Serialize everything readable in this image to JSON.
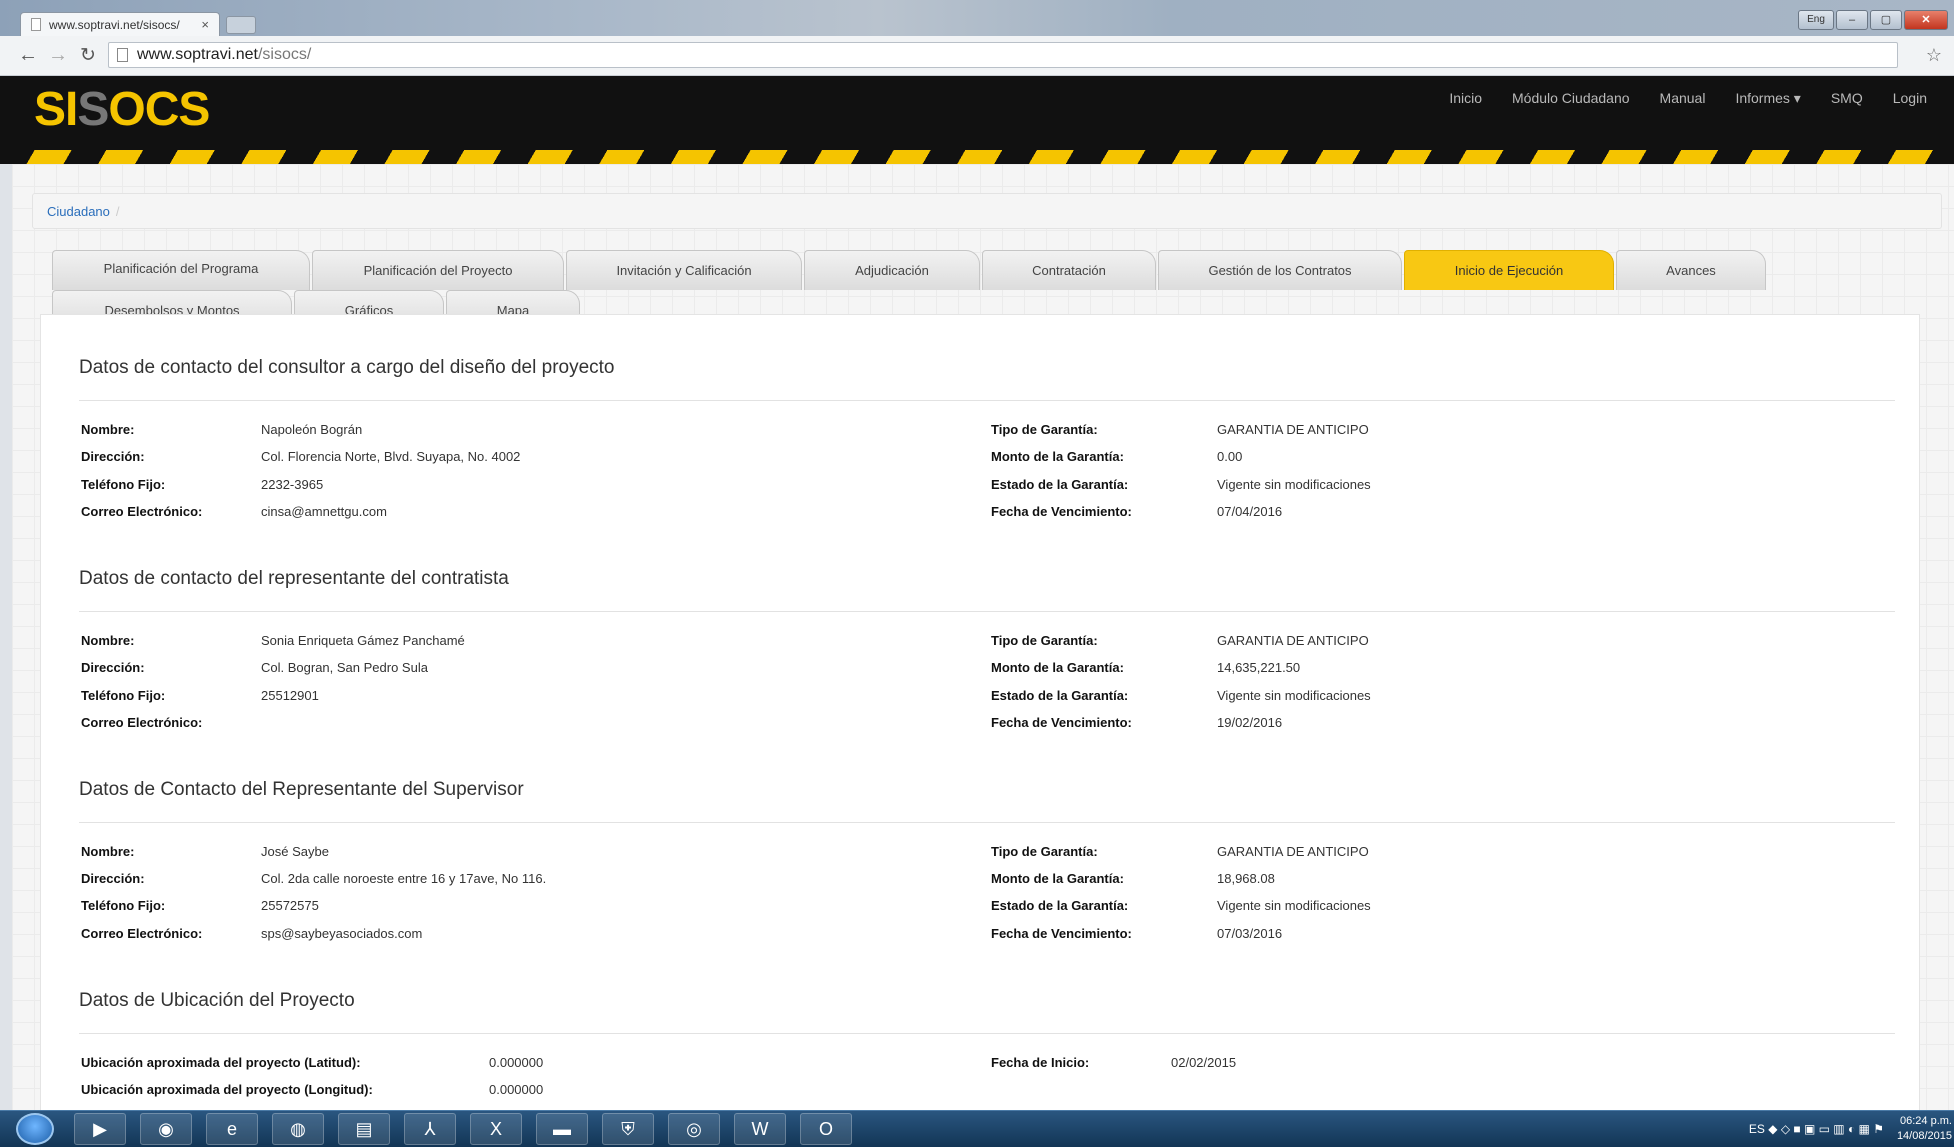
{
  "browser": {
    "tab_title": "www.soptravi.net/sisocs/",
    "tab_close": "×",
    "url_domain": "www.soptravi.net",
    "url_path": "/sisocs/",
    "win_lang": "Eng",
    "win_min": "–",
    "win_max": "▢",
    "win_close": "✕"
  },
  "site": {
    "logo_part1": "SI",
    "logo_s": "S",
    "logo_part2": "OCS",
    "nav": [
      "Inicio",
      "Módulo Ciudadano",
      "Manual",
      "Informes ▾",
      "SMQ",
      "Login"
    ]
  },
  "breadcrumb": {
    "item": "Ciudadano",
    "sep": "/"
  },
  "tabs_row1": [
    "Planificación del Programa",
    "Planificación del Proyecto",
    "Invitación y Calificación",
    "Adjudicación",
    "Contratación",
    "Gestión de los Contratos",
    "Inicio de Ejecución",
    "Avances"
  ],
  "tabs_row2": [
    "Desembolsos y Montos",
    "Gráficos",
    "Mapa"
  ],
  "labels": {
    "nombre": "Nombre:",
    "direccion": "Dirección:",
    "telefono": "Teléfono Fijo:",
    "correo": "Correo Electrónico:",
    "tipo_garantia": "Tipo de Garantía:",
    "monto_garantia": "Monto de la Garantía:",
    "estado_garantia": "Estado de la Garantía:",
    "fecha_vencimiento": "Fecha de Vencimiento:",
    "latitud": "Ubicación aproximada del proyecto (Latitud):",
    "longitud": "Ubicación aproximada del proyecto (Longitud):",
    "fecha_inicio": "Fecha de Inicio:"
  },
  "sections": [
    {
      "title": "Datos de contacto del consultor a cargo del diseño del proyecto",
      "nombre": "Napoleón Bográn",
      "direccion": "Col. Florencia Norte, Blvd. Suyapa, No. 4002",
      "telefono": "2232-3965",
      "correo": "cinsa@amnettgu.com",
      "tipo_garantia": "GARANTIA DE ANTICIPO",
      "monto_garantia": "0.00",
      "estado_garantia": "Vigente sin modificaciones",
      "fecha_vencimiento": "07/04/2016"
    },
    {
      "title": "Datos de contacto del representante del contratista",
      "nombre": "Sonia Enriqueta Gámez Panchamé",
      "direccion": "Col. Bogran, San Pedro Sula",
      "telefono": "25512901",
      "correo": "",
      "tipo_garantia": "GARANTIA DE ANTICIPO",
      "monto_garantia": "14,635,221.50",
      "estado_garantia": "Vigente sin modificaciones",
      "fecha_vencimiento": "19/02/2016"
    },
    {
      "title": "Datos de Contacto del Representante del Supervisor",
      "nombre": "José Saybe",
      "direccion": "Col. 2da calle noroeste entre 16 y 17ave, No 116.",
      "telefono": "25572575",
      "correo": "sps@saybeyasociados.com",
      "tipo_garantia": "GARANTIA DE ANTICIPO",
      "monto_garantia": "18,968.08",
      "estado_garantia": "Vigente sin modificaciones",
      "fecha_vencimiento": "07/03/2016"
    }
  ],
  "ubicacion": {
    "title": "Datos de Ubicación del Proyecto",
    "latitud": "0.000000",
    "longitud": "0.000000",
    "fecha_inicio": "02/02/2015"
  },
  "taskbar": {
    "tray_lang": "ES",
    "time": "06:24 p.m.",
    "date": "14/08/2015"
  },
  "colors": {
    "brand_yellow": "#f5c400",
    "active_tab": "#f8c813",
    "link": "#2a6ebb"
  }
}
